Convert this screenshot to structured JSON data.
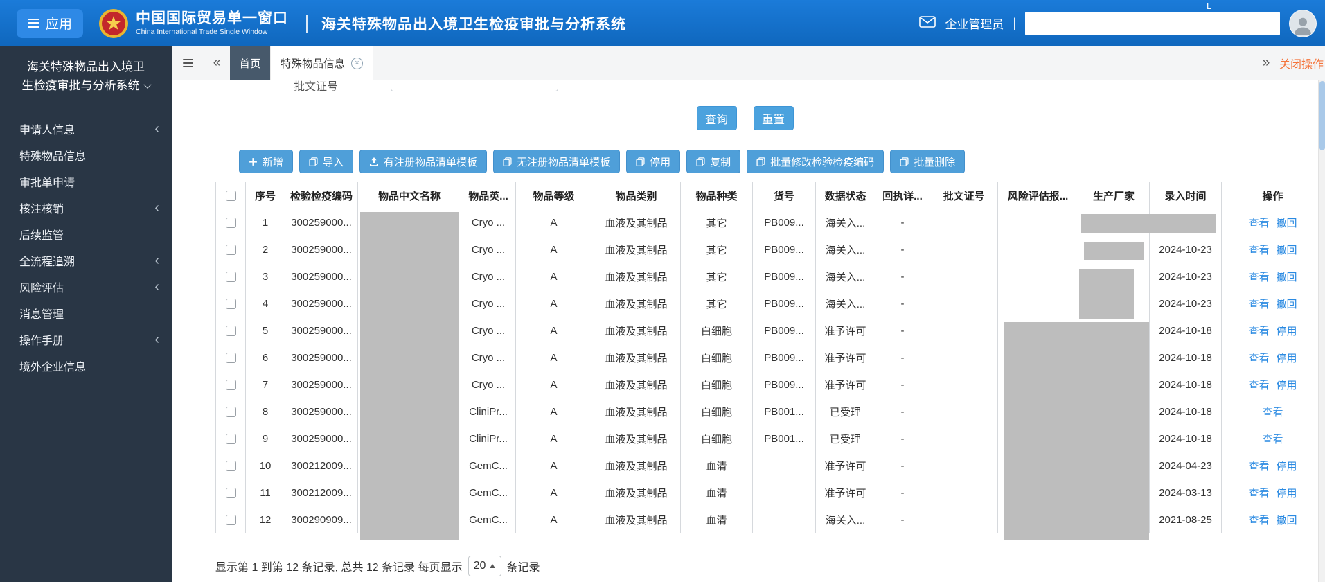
{
  "header": {
    "app_button": "应用",
    "brand_cn": "中国国际贸易单一窗口",
    "brand_en": "China International Trade Single Window",
    "system_title": "海关特殊物品出入境卫生检疫审批与分析系统",
    "user_role": "企业管理员",
    "separator": "|",
    "redaction_letter": "L",
    "header_blue": "#1372cc",
    "sidebar_color": "#293645",
    "button_blue": "#4f9fd9",
    "link_blue": "#2a8ae2"
  },
  "sidebar": {
    "title_line1": "海关特殊物品出入境卫",
    "title_line2": "生检疫审批与分析系统",
    "items": [
      {
        "label": "申请人信息",
        "name": "sidebar-item-applicant-info",
        "expandable": true
      },
      {
        "label": "特殊物品信息",
        "name": "sidebar-item-special-items-info",
        "expandable": false
      },
      {
        "label": "审批单申请",
        "name": "sidebar-item-approval-application",
        "expandable": false
      },
      {
        "label": "核注核销",
        "name": "sidebar-item-verification",
        "expandable": true
      },
      {
        "label": "后续监管",
        "name": "sidebar-item-followup-supervision",
        "expandable": false
      },
      {
        "label": "全流程追溯",
        "name": "sidebar-item-full-process-trace",
        "expandable": true
      },
      {
        "label": "风险评估",
        "name": "sidebar-item-risk-assessment",
        "expandable": true
      },
      {
        "label": "消息管理",
        "name": "sidebar-item-message-management",
        "expandable": false
      },
      {
        "label": "操作手册",
        "name": "sidebar-item-operation-manual",
        "expandable": true
      },
      {
        "label": "境外企业信息",
        "name": "sidebar-item-overseas-enterprise",
        "expandable": false
      }
    ]
  },
  "tabs": {
    "home": "首页",
    "active": "特殊物品信息",
    "close_ops": "关闭操作"
  },
  "form": {
    "visible_label": "批文证号"
  },
  "actions": {
    "query": "查询",
    "reset": "重置"
  },
  "toolbar": [
    {
      "label": "新增",
      "icon": "plus",
      "name": "add-button"
    },
    {
      "label": "导入",
      "icon": "doc",
      "name": "import-button"
    },
    {
      "label": "有注册物品清单模板",
      "icon": "upload",
      "name": "registered-list-template-button"
    },
    {
      "label": "无注册物品清单模板",
      "icon": "doc",
      "name": "unregistered-list-template-button"
    },
    {
      "label": "停用",
      "icon": "doc",
      "name": "disable-button"
    },
    {
      "label": "复制",
      "icon": "doc",
      "name": "copy-button"
    },
    {
      "label": "批量修改检验检疫编码",
      "icon": "doc",
      "name": "batch-edit-code-button"
    },
    {
      "label": "批量删除",
      "icon": "doc",
      "name": "batch-delete-button"
    }
  ],
  "table": {
    "columns": [
      "",
      "序号",
      "检验检疫编码",
      "物品中文名称",
      "物品英...",
      "物品等级",
      "物品类别",
      "物品种类",
      "货号",
      "数据状态",
      "回执详...",
      "批文证号",
      "风险评估报...",
      "生产厂家",
      "录入时间",
      "操作"
    ],
    "rows": [
      {
        "seq": "1",
        "code": "300259000...",
        "name_cn": "",
        "name_en": "Cryo ...",
        "grade": "A",
        "category": "血液及其制品",
        "kind": "其它",
        "item_no": "PB009...",
        "status": "海关入...",
        "receipt": "-",
        "permit_no": "",
        "risk_report": "",
        "manufacturer": "",
        "entry_time": "",
        "ops": [
          {
            "label": "查看",
            "action": "view"
          },
          {
            "label": "撤回",
            "action": "withdraw"
          }
        ]
      },
      {
        "seq": "2",
        "code": "300259000...",
        "name_cn": "",
        "name_en": "Cryo ...",
        "grade": "A",
        "category": "血液及其制品",
        "kind": "其它",
        "item_no": "PB009...",
        "status": "海关入...",
        "receipt": "-",
        "permit_no": "",
        "risk_report": "",
        "manufacturer": "",
        "entry_time": "2024-10-23",
        "ops": [
          {
            "label": "查看",
            "action": "view"
          },
          {
            "label": "撤回",
            "action": "withdraw"
          }
        ]
      },
      {
        "seq": "3",
        "code": "300259000...",
        "name_cn": "",
        "name_en": "Cryo ...",
        "grade": "A",
        "category": "血液及其制品",
        "kind": "其它",
        "item_no": "PB009...",
        "status": "海关入...",
        "receipt": "-",
        "permit_no": "",
        "risk_report": "",
        "manufacturer": "",
        "entry_time": "2024-10-23",
        "ops": [
          {
            "label": "查看",
            "action": "view"
          },
          {
            "label": "撤回",
            "action": "withdraw"
          }
        ]
      },
      {
        "seq": "4",
        "code": "300259000...",
        "name_cn": "",
        "name_en": "Cryo ...",
        "grade": "A",
        "category": "血液及其制品",
        "kind": "其它",
        "item_no": "PB009...",
        "status": "海关入...",
        "receipt": "-",
        "permit_no": "",
        "risk_report": "",
        "manufacturer": "",
        "entry_time": "2024-10-23",
        "ops": [
          {
            "label": "查看",
            "action": "view"
          },
          {
            "label": "撤回",
            "action": "withdraw"
          }
        ]
      },
      {
        "seq": "5",
        "code": "300259000...",
        "name_cn": "",
        "name_en": "Cryo ...",
        "grade": "A",
        "category": "血液及其制品",
        "kind": "白细胞",
        "item_no": "PB009...",
        "status": "准予许可",
        "receipt": "-",
        "permit_no": "",
        "risk_report": "",
        "manufacturer": "",
        "entry_time": "2024-10-18",
        "ops": [
          {
            "label": "查看",
            "action": "view"
          },
          {
            "label": "停用",
            "action": "disable"
          }
        ]
      },
      {
        "seq": "6",
        "code": "300259000...",
        "name_cn": "",
        "name_en": "Cryo ...",
        "grade": "A",
        "category": "血液及其制品",
        "kind": "白细胞",
        "item_no": "PB009...",
        "status": "准予许可",
        "receipt": "-",
        "permit_no": "",
        "risk_report": "",
        "manufacturer": "",
        "entry_time": "2024-10-18",
        "ops": [
          {
            "label": "查看",
            "action": "view"
          },
          {
            "label": "停用",
            "action": "disable"
          }
        ]
      },
      {
        "seq": "7",
        "code": "300259000...",
        "name_cn": "",
        "name_en": "Cryo ...",
        "grade": "A",
        "category": "血液及其制品",
        "kind": "白细胞",
        "item_no": "PB009...",
        "status": "准予许可",
        "receipt": "-",
        "permit_no": "",
        "risk_report": "",
        "manufacturer": "",
        "entry_time": "2024-10-18",
        "ops": [
          {
            "label": "查看",
            "action": "view"
          },
          {
            "label": "停用",
            "action": "disable"
          }
        ]
      },
      {
        "seq": "8",
        "code": "300259000...",
        "name_cn": "",
        "name_en": "CliniPr...",
        "grade": "A",
        "category": "血液及其制品",
        "kind": "白细胞",
        "item_no": "PB001...",
        "status": "已受理",
        "receipt": "-",
        "permit_no": "",
        "risk_report": "",
        "manufacturer": "",
        "entry_time": "2024-10-18",
        "ops": [
          {
            "label": "查看",
            "action": "view"
          }
        ]
      },
      {
        "seq": "9",
        "code": "300259000...",
        "name_cn": "",
        "name_en": "CliniPr...",
        "grade": "A",
        "category": "血液及其制品",
        "kind": "白细胞",
        "item_no": "PB001...",
        "status": "已受理",
        "receipt": "-",
        "permit_no": "",
        "risk_report": "",
        "manufacturer": "",
        "entry_time": "2024-10-18",
        "ops": [
          {
            "label": "查看",
            "action": "view"
          }
        ]
      },
      {
        "seq": "10",
        "code": "300212009...",
        "name_cn": "",
        "name_en": "GemC...",
        "grade": "A",
        "category": "血液及其制品",
        "kind": "血清",
        "item_no": "",
        "status": "准予许可",
        "receipt": "-",
        "permit_no": "",
        "risk_report": "",
        "manufacturer": "",
        "entry_time": "2024-04-23",
        "ops": [
          {
            "label": "查看",
            "action": "view"
          },
          {
            "label": "停用",
            "action": "disable"
          }
        ]
      },
      {
        "seq": "11",
        "code": "300212009...",
        "name_cn": "",
        "name_en": "GemC...",
        "grade": "A",
        "category": "血液及其制品",
        "kind": "血清",
        "item_no": "",
        "status": "准予许可",
        "receipt": "-",
        "permit_no": "",
        "risk_report": "",
        "manufacturer": "",
        "entry_time": "2024-03-13",
        "ops": [
          {
            "label": "查看",
            "action": "view"
          },
          {
            "label": "停用",
            "action": "disable"
          }
        ]
      },
      {
        "seq": "12",
        "code": "300290909...",
        "name_cn": "",
        "name_en": "GemC...",
        "grade": "A",
        "category": "血液及其制品",
        "kind": "血清",
        "item_no": "",
        "status": "海关入...",
        "receipt": "-",
        "permit_no": "",
        "risk_report": "",
        "manufacturer": "",
        "entry_time": "2021-08-25",
        "ops": [
          {
            "label": "查看",
            "action": "view"
          },
          {
            "label": "撤回",
            "action": "withdraw"
          }
        ]
      }
    ]
  },
  "pagination": {
    "text_before": "显示第 1 到第 12 条记录, 总共 12 条记录 每页显示",
    "page_size": "20",
    "text_after": "条记录"
  }
}
